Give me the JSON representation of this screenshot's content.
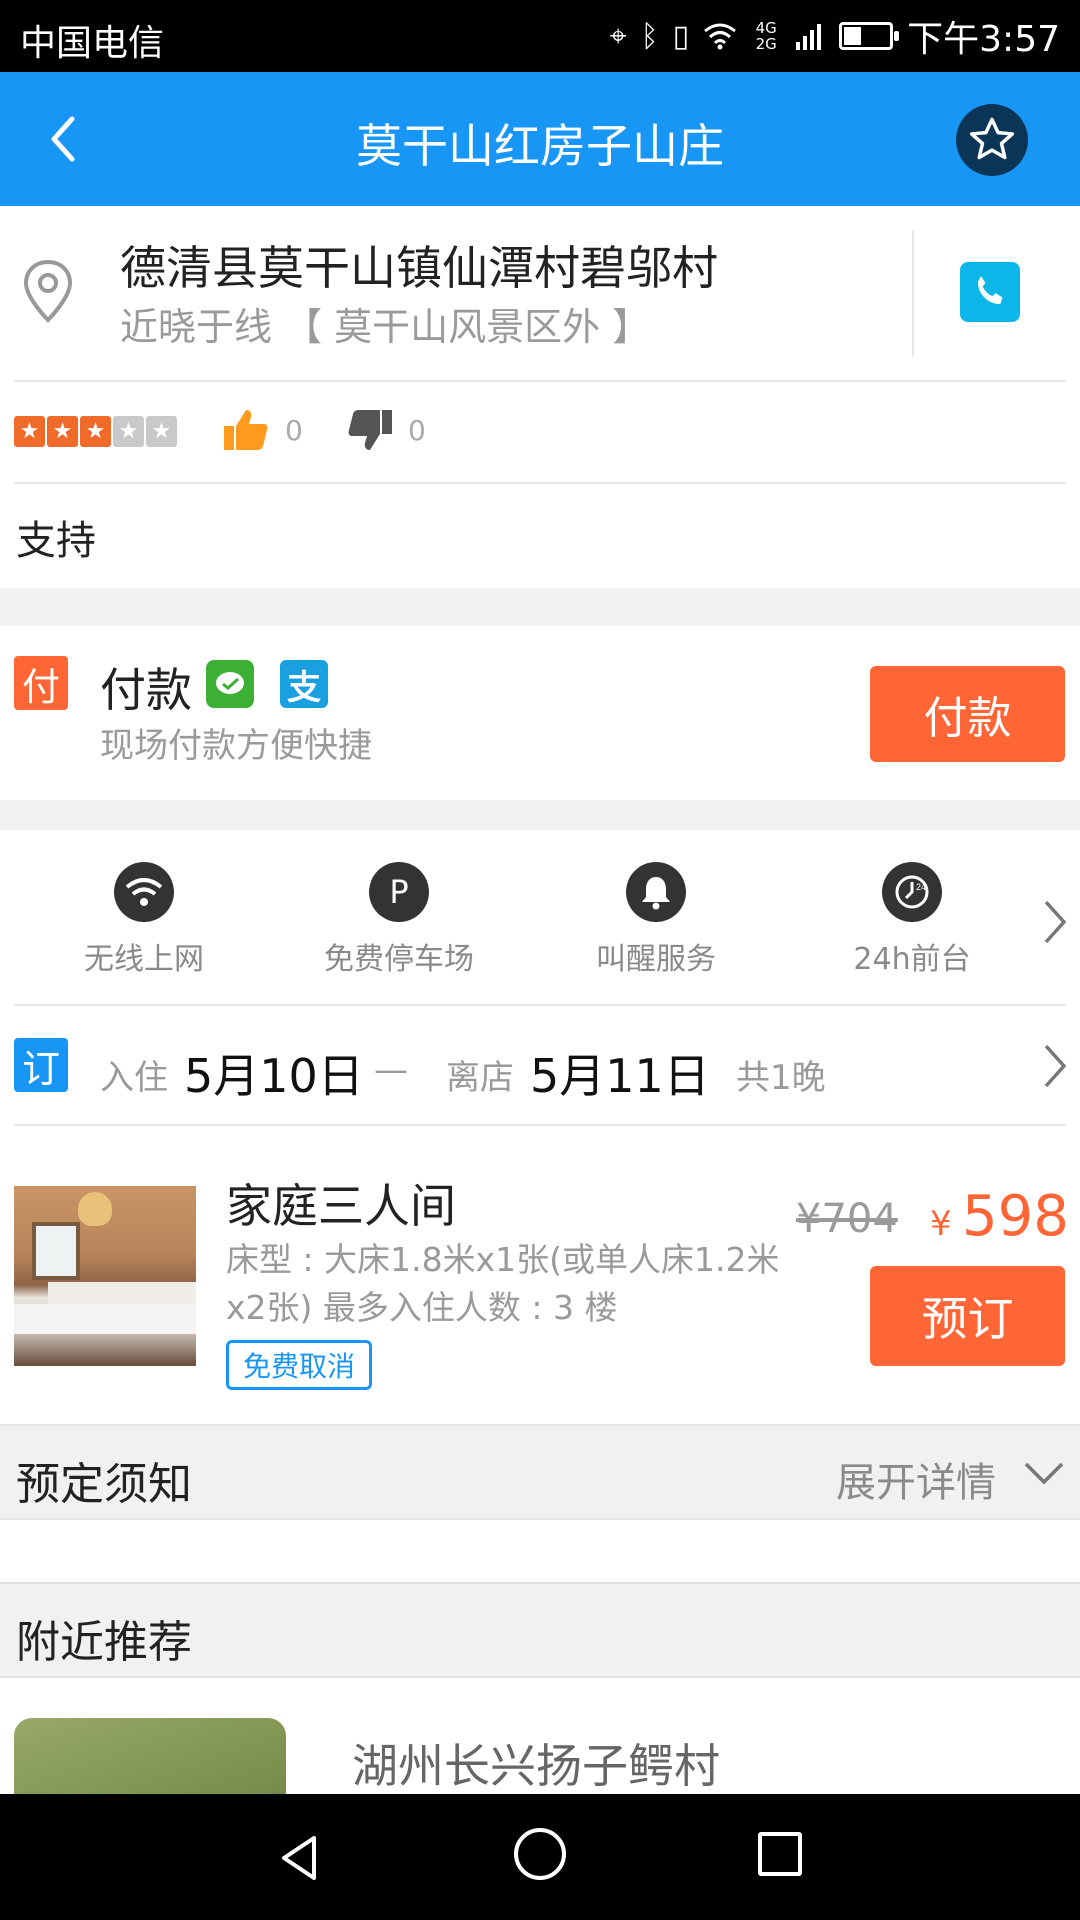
{
  "status_bar": {
    "carrier": "中国电信",
    "network": "4G 2G",
    "time": "下午3:57",
    "battery_level": 0.35
  },
  "header": {
    "title": "莫干山红房子山庄",
    "color": "#1796f5"
  },
  "address": {
    "main": "德清县莫干山镇仙潭村碧邬村",
    "sub": "近晓于线 【 莫干山风景区外 】"
  },
  "rating": {
    "stars_filled": 3,
    "stars_total": 5,
    "likes": "0",
    "dislikes": "0"
  },
  "support_text": "支持",
  "payment": {
    "badge": "付",
    "title": "付款",
    "alipay_glyph": "支",
    "subtitle": "现场付款方便快捷",
    "button": "付款",
    "accent": "#ff6535"
  },
  "amenities": [
    {
      "icon": "wifi-icon",
      "label": "无线上网"
    },
    {
      "icon": "parking-icon",
      "glyph": "P",
      "label": "免费停车场"
    },
    {
      "icon": "bell-icon",
      "label": "叫醒服务"
    },
    {
      "icon": "clock-24-icon",
      "label": "24h前台"
    }
  ],
  "booking": {
    "badge": "订",
    "checkin_label": "入住",
    "checkin_date": "5月10日",
    "dash": "—",
    "checkout_label": "离店",
    "checkout_date": "5月11日",
    "nights": "共1晚"
  },
  "room": {
    "name": "家庭三人间",
    "description": "床型 : 大床1.8米x1张(或单人床1.2米x2张)  最多入住人数 : 3 楼",
    "tag": "免费取消",
    "original_price": "¥704",
    "currency": "¥",
    "price": "598",
    "button": "预订"
  },
  "notice": {
    "title": "预定须知",
    "expand": "展开详情"
  },
  "nearby": {
    "title": "附近推荐",
    "items": [
      {
        "name": "湖州长兴扬子鳄村"
      }
    ]
  }
}
